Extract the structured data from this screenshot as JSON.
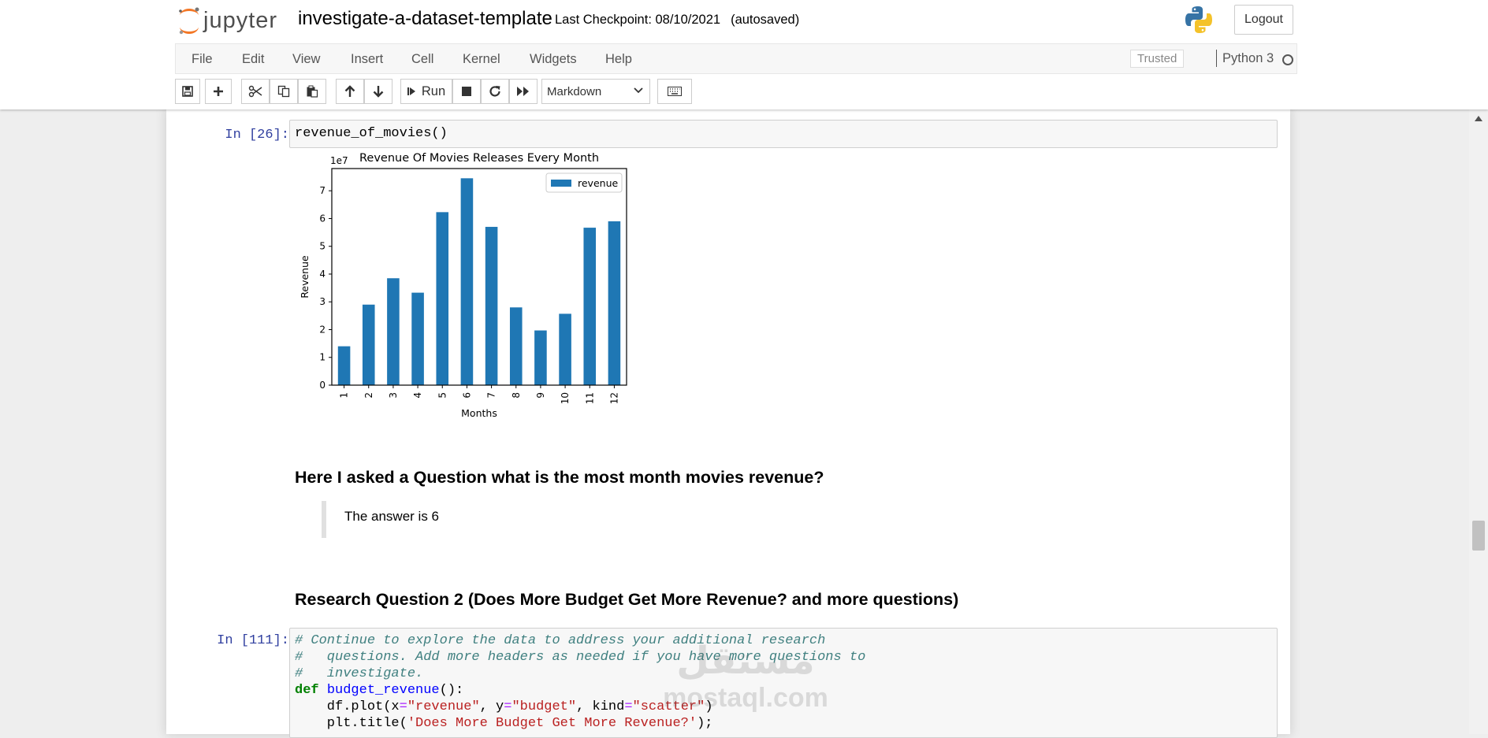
{
  "header": {
    "logo_text": "jupyter",
    "notebook_title": "investigate-a-dataset-template",
    "checkpoint": "Last Checkpoint: 08/10/2021",
    "autosaved": "(autosaved)",
    "logout": "Logout"
  },
  "menubar": {
    "items": [
      "File",
      "Edit",
      "View",
      "Insert",
      "Cell",
      "Kernel",
      "Widgets",
      "Help"
    ],
    "trusted": "Trusted",
    "kernel": "Python 3"
  },
  "toolbar": {
    "run_label": "Run",
    "cell_type": "Markdown"
  },
  "cells": {
    "cell1_prompt": "In [26]:",
    "cell1_code": "revenue_of_movies()",
    "heading1": "Here I asked a Question what is the most month movies revenue?",
    "answer": "The answer is 6",
    "heading2": "Research Question 2 (Does More Budget Get More Revenue? and more questions)",
    "cell2_prompt": "In [111]:",
    "cell2_lines": [
      "# Continue to explore the data to address your additional research",
      "#   questions. Add more headers as needed if you have more questions to",
      "#   investigate.",
      "def budget_revenue():",
      "    df.plot(x=\"revenue\", y=\"budget\", kind=\"scatter\")",
      "    plt.title('Does More Budget Get More Revenue?');"
    ]
  },
  "watermark": {
    "arabic": "مستقل",
    "latin": "mostaql.com"
  },
  "chart_data": {
    "type": "bar",
    "title": "Revenue Of Movies Releases Every Month",
    "xlabel": "Months",
    "ylabel": "Revenue",
    "scale_label": "1e7",
    "categories": [
      "1",
      "2",
      "3",
      "4",
      "5",
      "6",
      "7",
      "8",
      "9",
      "10",
      "11",
      "12"
    ],
    "series": [
      {
        "name": "revenue",
        "values": [
          1.4,
          2.9,
          3.85,
          3.33,
          6.23,
          7.45,
          5.7,
          2.8,
          1.97,
          2.57,
          5.67,
          5.9
        ]
      }
    ],
    "yticks": [
      "0",
      "1",
      "2",
      "3",
      "4",
      "5",
      "6",
      "7"
    ],
    "ylim": [
      0,
      7.8
    ],
    "legend_position": "upper right",
    "color": "#1f77b4",
    "grid": false
  }
}
